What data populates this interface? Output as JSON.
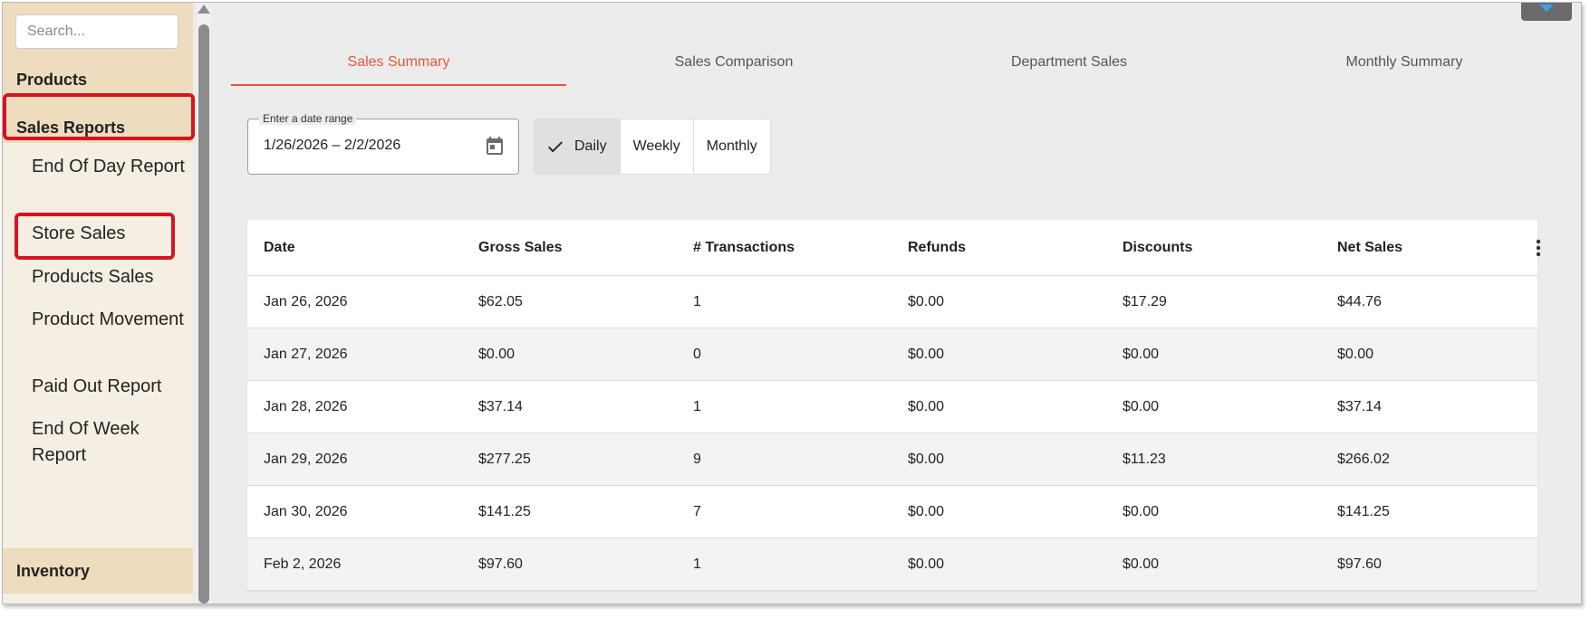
{
  "sidebar": {
    "search_placeholder": "Search...",
    "products_label": "Products",
    "sales_reports_label": "Sales Reports",
    "items": [
      {
        "label": "End Of Day Report"
      },
      {
        "label": "Store Sales"
      },
      {
        "label": "Products Sales"
      },
      {
        "label": "Product Movement"
      },
      {
        "label": "Paid Out Report"
      },
      {
        "label": "End Of Week Report"
      }
    ],
    "inventory_label": "Inventory"
  },
  "tabs": [
    {
      "label": "Sales Summary",
      "active": true
    },
    {
      "label": "Sales Comparison"
    },
    {
      "label": "Department Sales"
    },
    {
      "label": "Monthly Summary"
    }
  ],
  "date_range": {
    "legend": "Enter a date range",
    "value": "1/26/2026 – 2/2/2026",
    "icon": "calendar-icon"
  },
  "period_toggle": {
    "options": [
      "Daily",
      "Weekly",
      "Monthly"
    ],
    "selected": "Daily"
  },
  "table": {
    "columns": [
      "Date",
      "Gross Sales",
      "# Transactions",
      "Refunds",
      "Discounts",
      "Net Sales"
    ],
    "rows": [
      [
        "Jan 26, 2026",
        "$62.05",
        "1",
        "$0.00",
        "$17.29",
        "$44.76"
      ],
      [
        "Jan 27, 2026",
        "$0.00",
        "0",
        "$0.00",
        "$0.00",
        "$0.00"
      ],
      [
        "Jan 28, 2026",
        "$37.14",
        "1",
        "$0.00",
        "$0.00",
        "$37.14"
      ],
      [
        "Jan 29, 2026",
        "$277.25",
        "9",
        "$0.00",
        "$11.23",
        "$266.02"
      ],
      [
        "Jan 30, 2026",
        "$141.25",
        "7",
        "$0.00",
        "$0.00",
        "$141.25"
      ],
      [
        "Feb 2, 2026",
        "$97.60",
        "1",
        "$0.00",
        "$0.00",
        "$97.60"
      ]
    ]
  },
  "colors": {
    "accent": "#e8553d",
    "highlight": "#d9121e",
    "sidebar_bg": "#f5efe3",
    "section_bg": "#eddcbd"
  }
}
